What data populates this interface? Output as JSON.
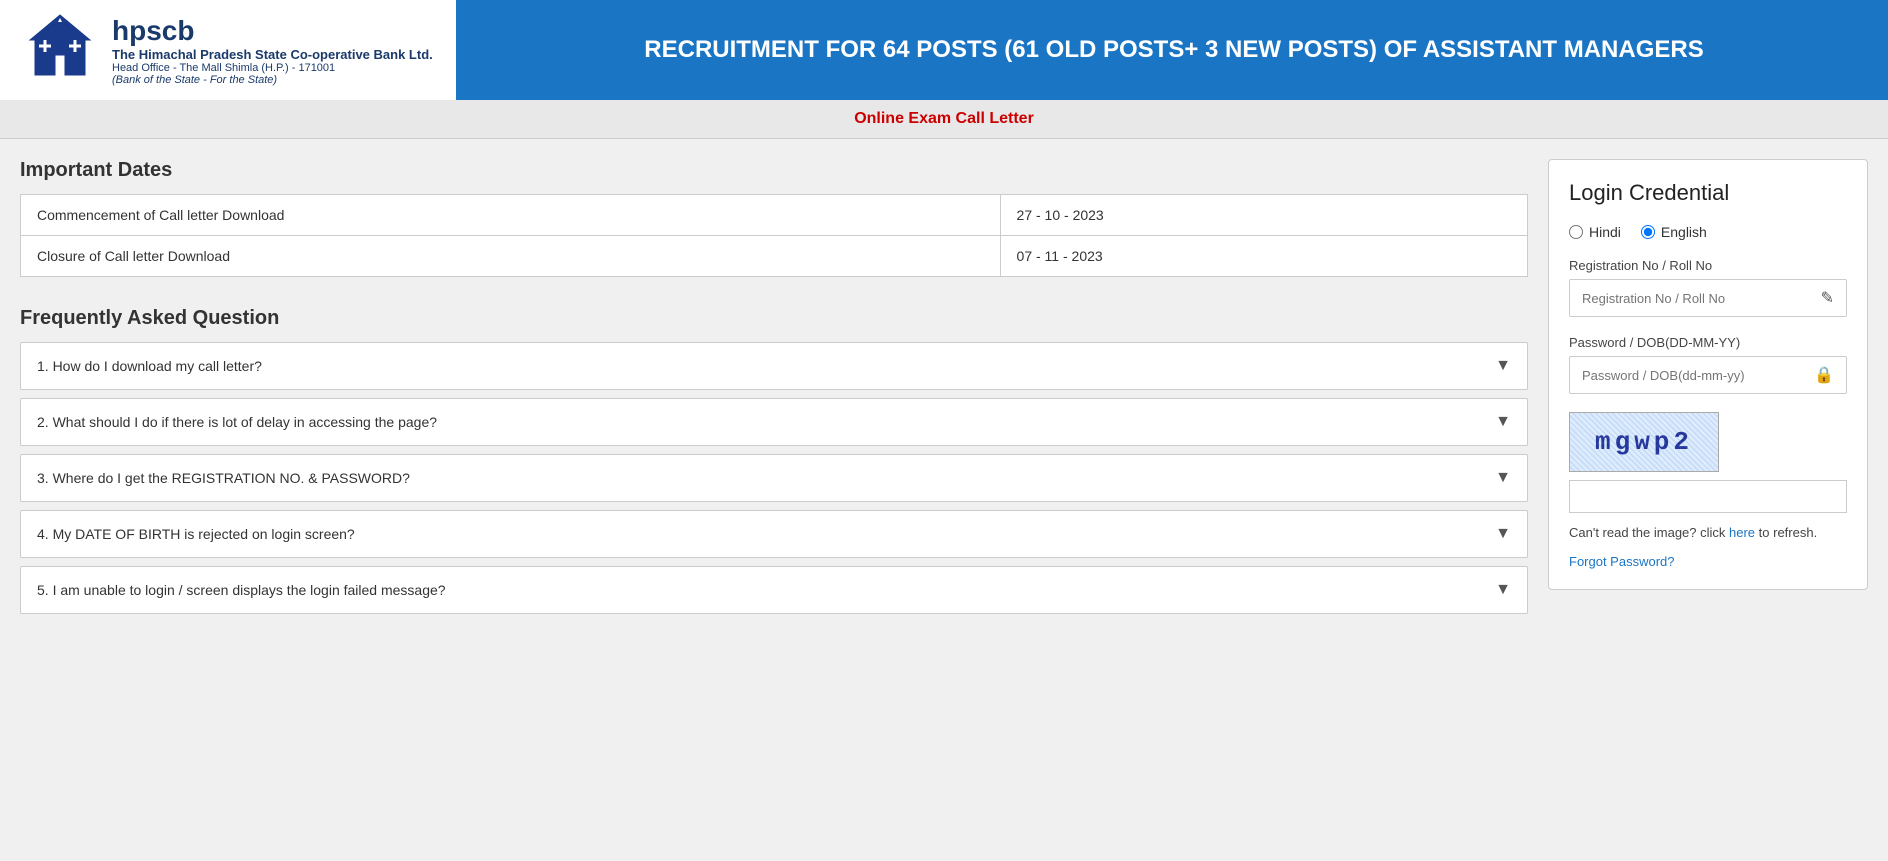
{
  "header": {
    "logo": {
      "hpscb": "hpscb",
      "bank_name": "The Himachal Pradesh State Co-operative Bank Ltd.",
      "head_office": "Head Office - The Mall Shimla (H.P.) - 171001",
      "tagline": "(Bank of the State - For the State)"
    },
    "title": "RECRUITMENT FOR 64 POSTS (61 old posts+ 3 new posts) OF ASSISTANT MANAGERS"
  },
  "sub_header": {
    "text": "Online Exam Call Letter"
  },
  "important_dates": {
    "section_title": "Important Dates",
    "rows": [
      {
        "label": "Commencement of Call letter Download",
        "date": "27 - 10 - 2023"
      },
      {
        "label": "Closure of Call letter Download",
        "date": "07 - 11 - 2023"
      }
    ]
  },
  "faq": {
    "section_title": "Frequently Asked Question",
    "items": [
      {
        "id": 1,
        "question": "1. How do I download my call letter?"
      },
      {
        "id": 2,
        "question": "2. What should I do if there is lot of delay in accessing the page?"
      },
      {
        "id": 3,
        "question": "3. Where do I get the REGISTRATION NO. & PASSWORD?"
      },
      {
        "id": 4,
        "question": "4. My DATE OF BIRTH is rejected on login screen?"
      },
      {
        "id": 5,
        "question": "5. I am unable to login / screen displays the login failed message?"
      }
    ]
  },
  "login": {
    "title": "Login Credential",
    "language": {
      "option1": "Hindi",
      "option2": "English",
      "selected": "English"
    },
    "registration_label": "Registration No / Roll No",
    "registration_placeholder": "Registration No / Roll No",
    "password_label": "Password / DOB(DD-MM-YY)",
    "password_placeholder": "Password / DOB(dd-mm-yy)",
    "captcha_text": "mgwp2",
    "captcha_note_prefix": "Can't read the image? click ",
    "captcha_link": "here",
    "captcha_note_suffix": " to refresh.",
    "forgot_password": "Forgot Password?"
  }
}
